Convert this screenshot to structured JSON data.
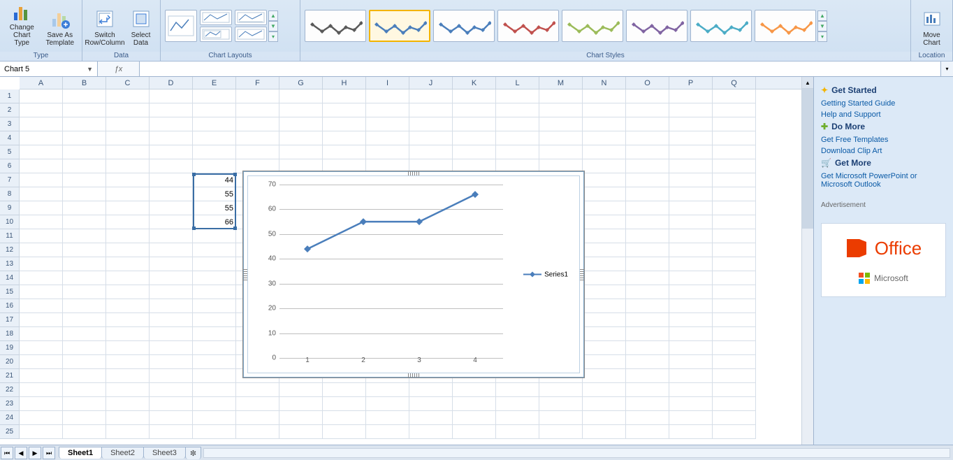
{
  "ribbon": {
    "groups": {
      "type": {
        "label": "Type",
        "change_chart_type": "Change\nChart Type",
        "save_as_template": "Save As\nTemplate"
      },
      "data": {
        "label": "Data",
        "switch": "Switch\nRow/Column",
        "select": "Select\nData"
      },
      "layouts": {
        "label": "Chart Layouts"
      },
      "styles": {
        "label": "Chart Styles"
      },
      "location": {
        "label": "Location",
        "move_chart": "Move\nChart"
      }
    },
    "style_colors": [
      "#595959",
      "#4a7ebb",
      "#4a7ebb",
      "#c0504d",
      "#9bbb59",
      "#8064a2",
      "#4bacc6",
      "#f79646"
    ],
    "selected_style": 1
  },
  "namebox": {
    "value": "Chart 5"
  },
  "columns": [
    "A",
    "B",
    "C",
    "D",
    "E",
    "F",
    "G",
    "H",
    "I",
    "J",
    "K",
    "L",
    "M",
    "N",
    "O",
    "P",
    "Q"
  ],
  "rows": 25,
  "cells": {
    "E7": "44",
    "E8": "55",
    "E9": "55",
    "E10": "66"
  },
  "chart_data": {
    "type": "line",
    "x": [
      1,
      2,
      3,
      4
    ],
    "series": [
      {
        "name": "Series1",
        "values": [
          44,
          55,
          55,
          66
        ]
      }
    ],
    "yticks": [
      0,
      10,
      20,
      30,
      40,
      50,
      60,
      70
    ],
    "ylim": [
      0,
      70
    ]
  },
  "legend_label": "Series1",
  "side": {
    "get_started": {
      "title": "Get Started",
      "links": [
        "Getting Started Guide",
        "Help and Support"
      ]
    },
    "do_more": {
      "title": "Do More",
      "links": [
        "Get Free Templates",
        "Download Clip Art"
      ]
    },
    "get_more": {
      "title": "Get More",
      "links": [
        "Get Microsoft PowerPoint or Microsoft Outlook"
      ]
    },
    "ad_label": "Advertisement",
    "ad_brand": "Office",
    "ad_company": "Microsoft"
  },
  "tabs": {
    "sheets": [
      "Sheet1",
      "Sheet2",
      "Sheet3"
    ],
    "active": 0
  }
}
